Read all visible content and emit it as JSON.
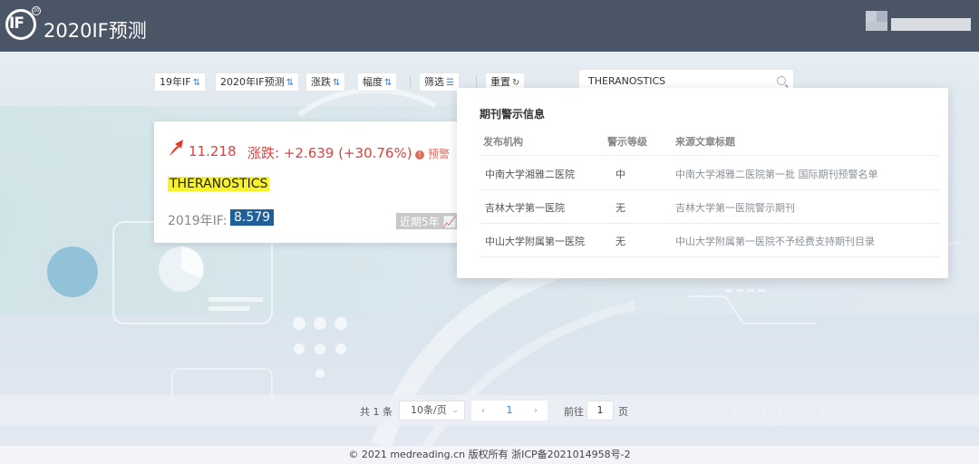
{
  "header": {
    "logo_text": "IF",
    "logo_badge": "20",
    "title": "2020IF预测"
  },
  "toolbar": {
    "chips": [
      {
        "label": "19年IF"
      },
      {
        "label": "2020年IF预测"
      },
      {
        "label": "涨跌"
      },
      {
        "label": "幅度"
      }
    ],
    "filter_label": "筛选",
    "reset_label": "重置",
    "search_value": "THERANOSTICS"
  },
  "card": {
    "predicted_if": "11.218",
    "change_text": "涨跌: +2.639 (+30.76%)",
    "warning_label": "预警",
    "journal_name": "THERANOSTICS",
    "prev_if_label": "2019年IF:",
    "prev_if_value": "8.579",
    "five_year_label": "近期5年"
  },
  "alert_panel": {
    "title": "期刊警示信息",
    "headers": [
      "发布机构",
      "警示等级",
      "来源文章标题"
    ],
    "rows": [
      {
        "org": "中南大学湘雅二医院",
        "level": "中",
        "source": "中南大学湘雅二医院第一批 国际期刊预警名单"
      },
      {
        "org": "吉林大学第一医院",
        "level": "无",
        "source": "吉林大学第一医院警示期刊"
      },
      {
        "org": "中山大学附属第一医院",
        "level": "无",
        "source": "中山大学附属第一医院不予经费支持期刊目录"
      }
    ]
  },
  "pagination": {
    "total": "共 1 条",
    "page_size": "10条/页",
    "current_page": "1",
    "goto_label": "前往",
    "goto_value": "1",
    "page_unit": "页"
  },
  "footer": {
    "text": "© 2021 medreading.cn 版权所有 浙ICP备2021014958号-2"
  }
}
